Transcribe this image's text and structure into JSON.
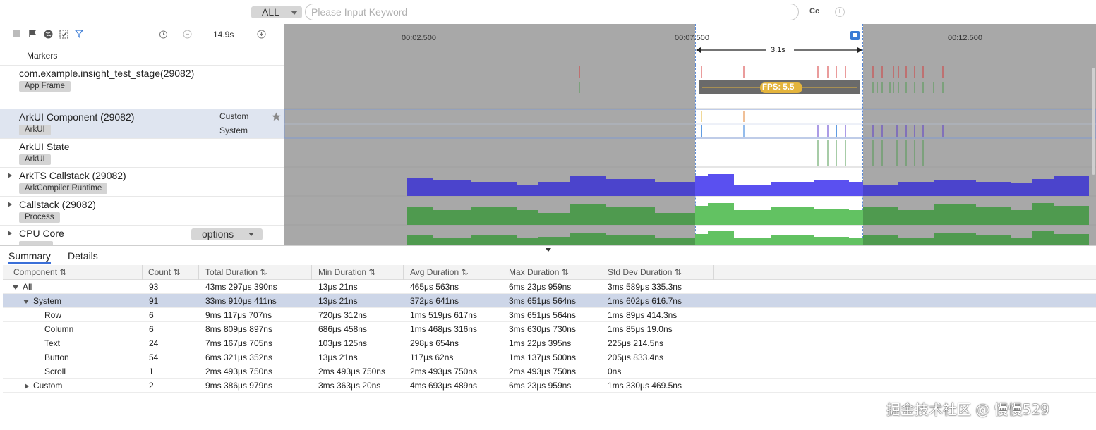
{
  "search": {
    "scope": "ALL",
    "placeholder": "Please Input Keyword",
    "case_label": "Cc"
  },
  "toolbar": {
    "zoom": "14.9s"
  },
  "timeline": {
    "ticks": [
      "00:02.500",
      "00:07.500",
      "00:12.500"
    ],
    "selection_duration": "3.1s",
    "fps_label": "FPS: 5.5"
  },
  "rows": [
    {
      "name": "Markers"
    },
    {
      "name": "com.example.insight_test_stage(29082)",
      "tag": "App Frame"
    },
    {
      "name": "ArkUI Component (29082)",
      "tag": "ArkUI",
      "sub": [
        "Custom",
        "System"
      ]
    },
    {
      "name": "ArkUI State",
      "tag": "ArkUI"
    },
    {
      "name": "ArkTS Callstack (29082)",
      "tag": "ArkCompiler Runtime"
    },
    {
      "name": "Callstack (29082)",
      "tag": "Process"
    },
    {
      "name": "CPU Core",
      "tag": "",
      "options": "options"
    }
  ],
  "tabs": [
    "Summary",
    "Details"
  ],
  "table": {
    "columns": [
      "Component",
      "Count",
      "Total Duration",
      "Min Duration",
      "Avg Duration",
      "Max Duration",
      "Std Dev Duration"
    ],
    "rows": [
      {
        "component": "All",
        "count": "93",
        "total": "43ms 297μs 390ns",
        "min": "13μs 21ns",
        "avg": "465μs 563ns",
        "max": "6ms 23μs 959ns",
        "std": "3ms 589μs 335.3ns"
      },
      {
        "component": "System",
        "count": "91",
        "total": "33ms 910μs 411ns",
        "min": "13μs 21ns",
        "avg": "372μs 641ns",
        "max": "3ms 651μs 564ns",
        "std": "1ms 602μs 616.7ns"
      },
      {
        "component": "Row",
        "count": "6",
        "total": "9ms 117μs 707ns",
        "min": "720μs 312ns",
        "avg": "1ms 519μs 617ns",
        "max": "3ms 651μs 564ns",
        "std": "1ms 89μs 414.3ns"
      },
      {
        "component": "Column",
        "count": "6",
        "total": "8ms 809μs 897ns",
        "min": "686μs 458ns",
        "avg": "1ms 468μs 316ns",
        "max": "3ms 630μs 730ns",
        "std": "1ms 85μs 19.0ns"
      },
      {
        "component": "Text",
        "count": "24",
        "total": "7ms 167μs 705ns",
        "min": "103μs 125ns",
        "avg": "298μs 654ns",
        "max": "1ms 22μs 395ns",
        "std": "225μs 214.5ns"
      },
      {
        "component": "Button",
        "count": "54",
        "total": "6ms 321μs 352ns",
        "min": "13μs 21ns",
        "avg": "117μs 62ns",
        "max": "1ms 137μs 500ns",
        "std": "205μs 833.4ns"
      },
      {
        "component": "Scroll",
        "count": "1",
        "total": "2ms 493μs 750ns",
        "min": "2ms 493μs 750ns",
        "avg": "2ms 493μs 750ns",
        "max": "2ms 493μs 750ns",
        "std": "0ns"
      },
      {
        "component": "Custom",
        "count": "2",
        "total": "9ms 386μs 979ns",
        "min": "3ms 363μs 20ns",
        "avg": "4ms 693μs 489ns",
        "max": "6ms 23μs 959ns",
        "std": "1ms 330μs 469.5ns"
      }
    ]
  },
  "watermark": "掘金技术社区 @ 慢慢529",
  "colors": {
    "arkts_track": "#4b44cc",
    "callstack_track": "#4f9a4f",
    "selection_border": "#5a8ad8",
    "fps_badge": "#e4b43c"
  }
}
